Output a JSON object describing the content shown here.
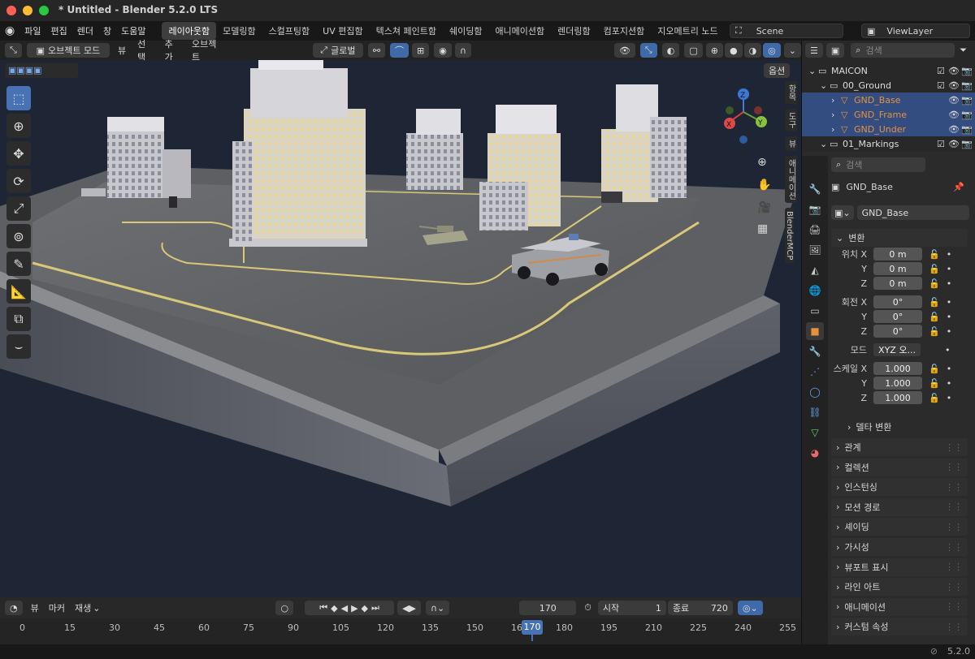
{
  "window": {
    "title": "* Untitled - Blender 5.2.0 LTS"
  },
  "menu": [
    "파일",
    "편집",
    "렌더",
    "창",
    "도움말"
  ],
  "workspaces": [
    "레이아웃함",
    "모델링함",
    "스컬프팅함",
    "UV 편집함",
    "텍스쳐 페인트함",
    "쉐이딩함",
    "애니메이션함",
    "렌더링함",
    "컴포지션함",
    "지오메트리 노드",
    "스크"
  ],
  "scene": "Scene",
  "view_layer": "ViewLayer",
  "viewport_header": {
    "mode": "오브젝트 모드",
    "view": "뷰",
    "select": "선택",
    "add": "추가",
    "object": "오브젝트",
    "transform": "글로벌",
    "options": "옵션"
  },
  "nav_tabs": [
    "항목",
    "도구",
    "뷰",
    "애니메이션",
    "BlenderMCP"
  ],
  "outliner": {
    "search": "검색",
    "rows": [
      {
        "label": "MAICON",
        "indent": 0
      },
      {
        "label": "00_Ground",
        "indent": 1
      },
      {
        "label": "GND_Base",
        "indent": 2,
        "sel": true
      },
      {
        "label": "GND_Frame",
        "indent": 2,
        "sel": true
      },
      {
        "label": "GND_Under",
        "indent": 2,
        "sel": true
      },
      {
        "label": "01_Markings",
        "indent": 1
      }
    ]
  },
  "properties": {
    "search": "검색",
    "object_name": "GND_Base",
    "data_name": "GND_Base",
    "transform": "변환",
    "loc_label": "위치 X",
    "rot_label": "회전 X",
    "scale_label": "스케일 X",
    "mode_label": "모드",
    "y": "Y",
    "z": "Z",
    "loc": [
      "0 m",
      "0 m",
      "0 m"
    ],
    "rot": [
      "0°",
      "0°",
      "0°"
    ],
    "mode": "XYZ 오...",
    "scale": [
      "1.000",
      "1.000",
      "1.000"
    ],
    "delta": "델타 변환",
    "sections": [
      "관계",
      "컬렉션",
      "인스턴싱",
      "모션 경로",
      "셰이딩",
      "가시성",
      "뷰포트 표시",
      "라인 아트",
      "애니메이션",
      "커스텀 속성"
    ]
  },
  "timeline": {
    "view": "뷰",
    "marker": "마커",
    "playback": "재생",
    "current": "170",
    "start_label": "시작",
    "start": "1",
    "end_label": "종료",
    "end": "720",
    "ticks": [
      "0",
      "15",
      "30",
      "45",
      "60",
      "75",
      "90",
      "105",
      "120",
      "135",
      "150",
      "16",
      "180",
      "195",
      "210",
      "225",
      "240",
      "255"
    ],
    "playhead": "170"
  },
  "status": {
    "version": "5.2.0"
  },
  "colors": {
    "accent": "#4772b3",
    "selected_row": "#334d80",
    "orange": "#e8913a"
  }
}
